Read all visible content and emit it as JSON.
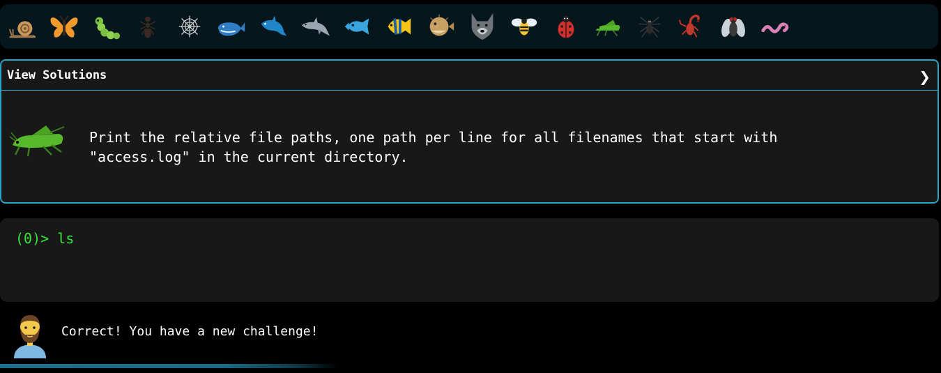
{
  "creatures": [
    {
      "name": "snail-icon"
    },
    {
      "name": "butterfly-icon"
    },
    {
      "name": "caterpillar-icon"
    },
    {
      "name": "ant-icon"
    },
    {
      "name": "spider-web-icon"
    },
    {
      "name": "whale-icon"
    },
    {
      "name": "blue-dolphin-icon"
    },
    {
      "name": "dolphin-icon"
    },
    {
      "name": "fish-icon"
    },
    {
      "name": "tropical-fish-icon"
    },
    {
      "name": "blowfish-icon"
    },
    {
      "name": "wolf-icon"
    },
    {
      "name": "honeybee-icon"
    },
    {
      "name": "ladybug-icon"
    },
    {
      "name": "cricket-icon"
    },
    {
      "name": "spider-icon"
    },
    {
      "name": "scorpion-icon"
    },
    {
      "name": "fly-icon"
    },
    {
      "name": "worm-icon"
    }
  ],
  "solutions": {
    "title": "View Solutions",
    "chevron": "❯"
  },
  "challenge": {
    "icon": "cricket-icon",
    "text": "Print the relative file paths, one path per line for all filenames that start with\n\"access.log\" in the current directory."
  },
  "terminal": {
    "prompt": "(0)> ",
    "command": "ls",
    "line": "(0)> ls"
  },
  "feedback": {
    "avatar": "bearded-man-icon",
    "message": "Correct! You have a new challenge!"
  },
  "progress": {
    "fraction": 0.6
  },
  "colors": {
    "accent": "#29a7c9",
    "terminal_text": "#39e639",
    "panel_bg": "#181818",
    "bar_bg": "#06161d"
  }
}
